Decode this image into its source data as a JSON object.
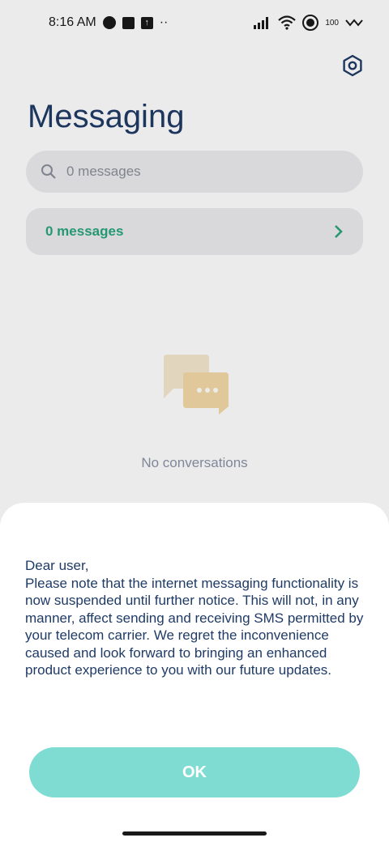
{
  "status_bar": {
    "time": "8:16 AM",
    "battery": "100"
  },
  "header": {
    "title": "Messaging"
  },
  "search": {
    "placeholder": "0 messages"
  },
  "messages_row": {
    "label": "0 messages"
  },
  "empty_state": {
    "text": "No conversations"
  },
  "dialog": {
    "message": "Dear user,\nPlease note that the internet messaging functionality is now suspended until further notice. This will not, in any manner, affect sending and receiving SMS permitted by your telecom carrier. We regret the inconvenience caused and look forward to bringing an enhanced product experience to you with our future updates.",
    "ok_label": "OK"
  },
  "colors": {
    "title": "#1f3b66",
    "accent_green": "#2aa57a",
    "ok_button": "#7fdcd3"
  },
  "icons": [
    "settings-icon",
    "search-icon",
    "chevron-right-icon",
    "chat-bubbles-icon"
  ]
}
